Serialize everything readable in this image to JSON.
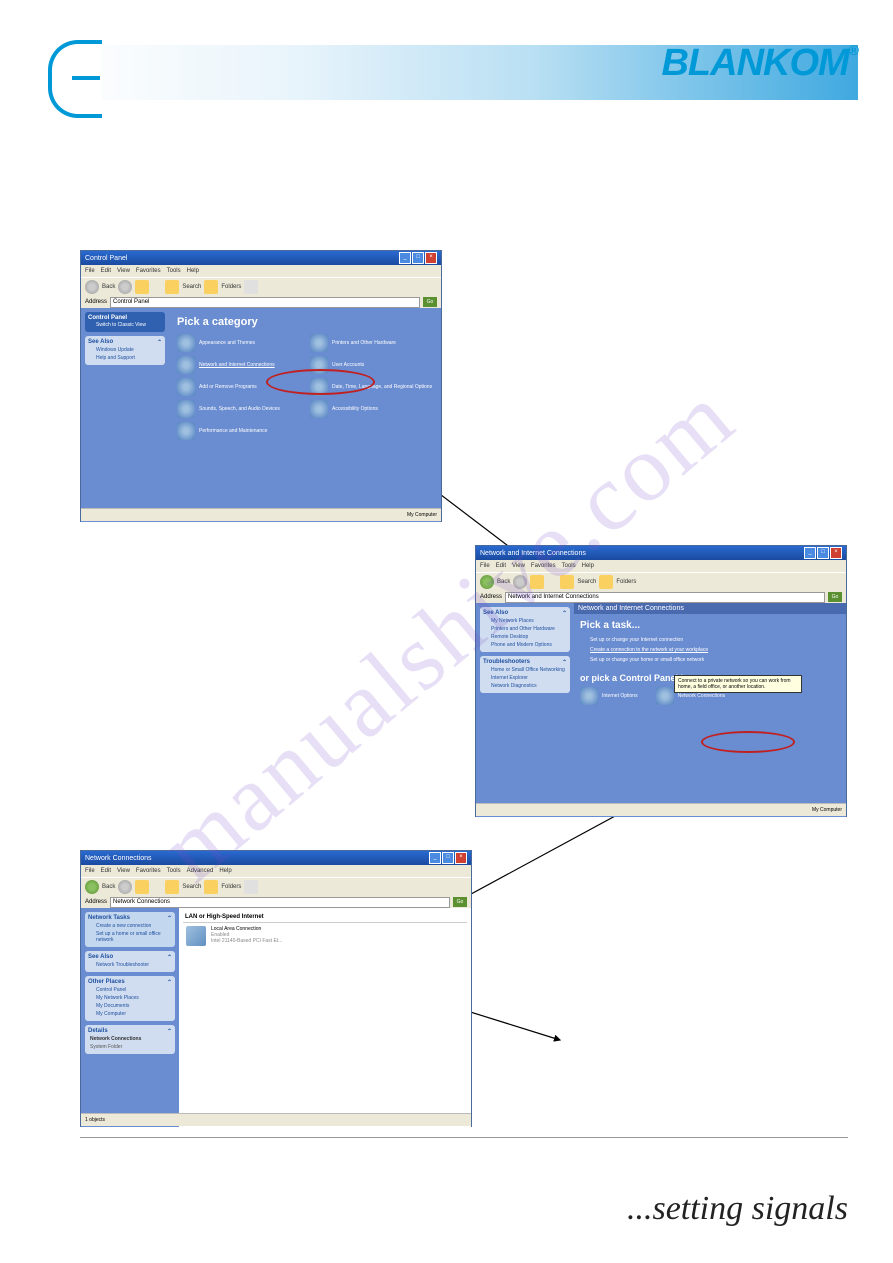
{
  "logo": {
    "text": "BLANKOM",
    "reg": "®"
  },
  "tagline": "...setting signals",
  "watermark": "manualshive.com",
  "win1": {
    "title": "Control Panel",
    "menus": [
      "File",
      "Edit",
      "View",
      "Favorites",
      "Tools",
      "Help"
    ],
    "back": "Back",
    "search": "Search",
    "folders": "Folders",
    "address_label": "Address",
    "address_value": "Control Panel",
    "go": "Go",
    "side": {
      "cp_head": "Control Panel",
      "cp_switch": "Switch to Classic View",
      "sa_head": "See Also",
      "sa1": "Windows Update",
      "sa2": "Help and Support"
    },
    "heading": "Pick a category",
    "cats": [
      "Appearance and Themes",
      "Printers and Other Hardware",
      "Network and Internet Connections",
      "User Accounts",
      "Add or Remove Programs",
      "Date, Time, Language, and Regional Options",
      "Sounds, Speech, and Audio Devices",
      "Accessibility Options",
      "Performance and Maintenance"
    ],
    "status": "My Computer"
  },
  "win2": {
    "title": "Network and Internet Connections",
    "menus": [
      "File",
      "Edit",
      "View",
      "Favorites",
      "Tools",
      "Help"
    ],
    "back": "Back",
    "search": "Search",
    "folders": "Folders",
    "address_label": "Address",
    "address_value": "Network and Internet Connections",
    "go": "Go",
    "side": {
      "sa_head": "See Also",
      "sa1": "My Network Places",
      "sa2": "Printers and Other Hardware",
      "sa3": "Remote Desktop",
      "sa4": "Phone and Modem Options",
      "tr_head": "Troubleshooters",
      "tr1": "Home or Small Office Networking",
      "tr2": "Internet Explorer",
      "tr3": "Network Diagnostics"
    },
    "banner": "Network and Internet Connections",
    "taskhead": "Pick a task...",
    "tasks": [
      "Set up or change your Internet connection",
      "Create a connection to the network at your workplace",
      "Set up or change your home or small office network"
    ],
    "tooltip": "Connect to a private network so you can work from home, a field office, or another location.",
    "iconhead": "or pick a Control Panel icon",
    "icons": [
      "Internet Options",
      "Network Connections"
    ],
    "status": "My Computer"
  },
  "win3": {
    "title": "Network Connections",
    "menus": [
      "File",
      "Edit",
      "View",
      "Favorites",
      "Tools",
      "Advanced",
      "Help"
    ],
    "back": "Back",
    "search": "Search",
    "folders": "Folders",
    "address_label": "Address",
    "address_value": "Network Connections",
    "go": "Go",
    "side": {
      "nt_head": "Network Tasks",
      "nt1": "Create a new connection",
      "nt2": "Set up a home or small office network",
      "sa_head": "See Also",
      "sa1": "Network Troubleshooter",
      "op_head": "Other Places",
      "op1": "Control Panel",
      "op2": "My Network Places",
      "op3": "My Documents",
      "op4": "My Computer",
      "de_head": "Details",
      "de1": "Network Connections",
      "de2": "System Folder"
    },
    "group": "LAN or High-Speed Internet",
    "conn_name": "Local Area Connection",
    "conn_status": "Enabled",
    "conn_adapter": "Intel 21140-Based PCI Fast Et...",
    "status_left": "1 objects"
  }
}
